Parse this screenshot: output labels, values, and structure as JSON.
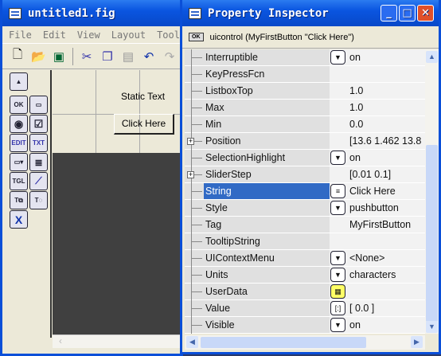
{
  "figure_window": {
    "title": "untitled1.fig",
    "menu": [
      "File",
      "Edit",
      "View",
      "Layout",
      "Tools"
    ],
    "toolbar_icons": [
      "new-file-icon",
      "open-folder-icon",
      "save-icon",
      "cut-icon",
      "copy-icon",
      "paste-icon",
      "undo-icon",
      "redo-icon"
    ],
    "palette": [
      "select",
      "OK",
      "SLDR",
      "radio",
      "check",
      "EDIT",
      "TXT",
      "POP",
      "list",
      "TGL",
      "axes",
      "panel",
      "buttongroup",
      "activex"
    ],
    "canvas": {
      "static_text": "Static Text",
      "button": "Click Here"
    }
  },
  "inspector": {
    "title": "Property Inspector",
    "header": "uicontrol (MyFirstButton \"Click Here\")",
    "header_icon": "OK",
    "selected_property": "String",
    "selection_color": "#316ac5",
    "rows": [
      {
        "name": "Interruptible",
        "value": "on",
        "editor": "dropdown"
      },
      {
        "name": "KeyPressFcn",
        "value": "",
        "editor": ""
      },
      {
        "name": "ListboxTop",
        "value": "1.0",
        "editor": ""
      },
      {
        "name": "Max",
        "value": "1.0",
        "editor": ""
      },
      {
        "name": "Min",
        "value": "0.0",
        "editor": ""
      },
      {
        "name": "Position",
        "value": "[13.6 1.462 13.8",
        "editor": "",
        "expand": true
      },
      {
        "name": "SelectionHighlight",
        "value": "on",
        "editor": "dropdown"
      },
      {
        "name": "SliderStep",
        "value": "[0.01 0.1]",
        "editor": "",
        "expand": true
      },
      {
        "name": "String",
        "value": "Click Here",
        "editor": "text"
      },
      {
        "name": "Style",
        "value": "pushbutton",
        "editor": "dropdown"
      },
      {
        "name": "Tag",
        "value": "MyFirstButton",
        "editor": ""
      },
      {
        "name": "TooltipString",
        "value": "",
        "editor": ""
      },
      {
        "name": "UIContextMenu",
        "value": "<None>",
        "editor": "dropdown"
      },
      {
        "name": "Units",
        "value": "characters",
        "editor": "dropdown"
      },
      {
        "name": "UserData",
        "value": "",
        "editor": "grid"
      },
      {
        "name": "Value",
        "value": "[ 0.0 ]",
        "editor": "array"
      },
      {
        "name": "Visible",
        "value": "on",
        "editor": "dropdown"
      }
    ]
  }
}
